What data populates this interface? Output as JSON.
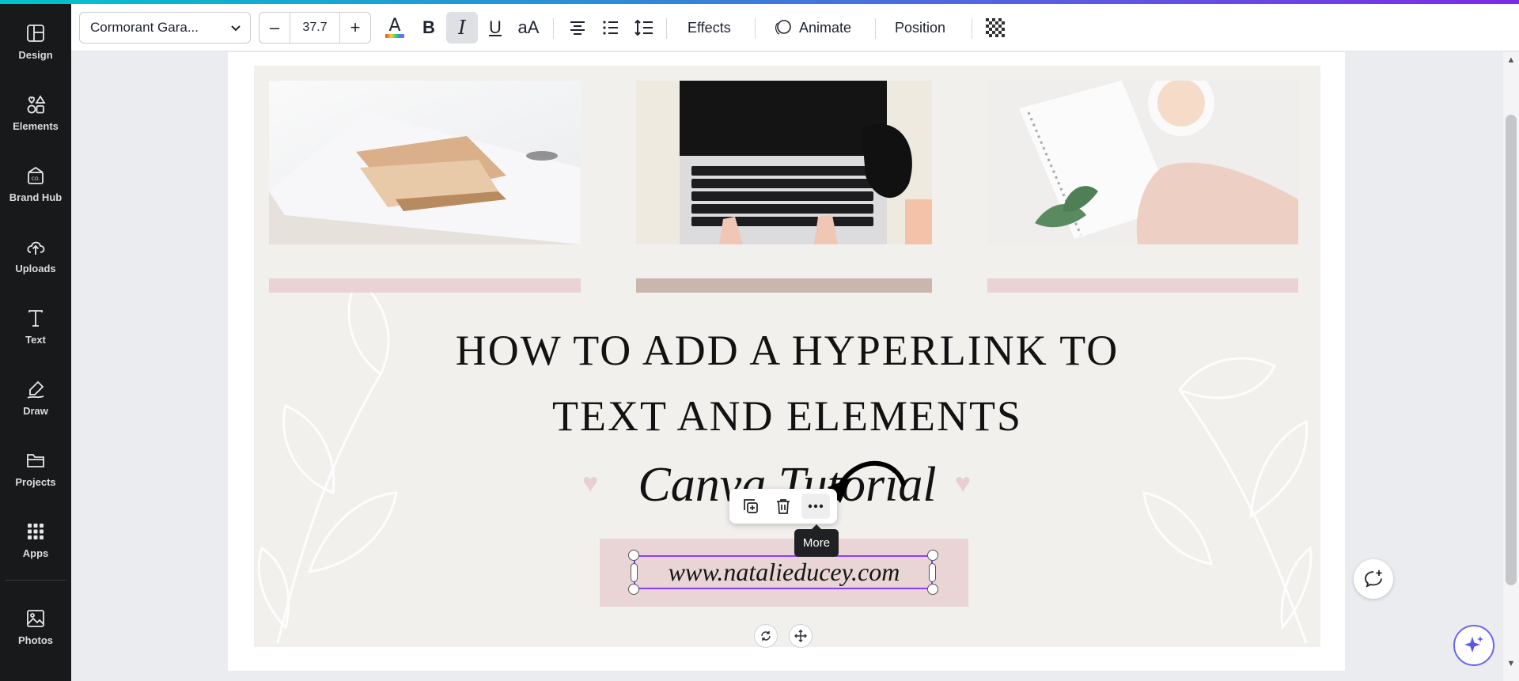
{
  "sidebar": {
    "items": [
      {
        "label": "Design",
        "icon": "design-icon"
      },
      {
        "label": "Elements",
        "icon": "elements-icon"
      },
      {
        "label": "Brand Hub",
        "icon": "brand-hub-icon"
      },
      {
        "label": "Uploads",
        "icon": "uploads-icon"
      },
      {
        "label": "Text",
        "icon": "text-icon"
      },
      {
        "label": "Draw",
        "icon": "draw-icon"
      },
      {
        "label": "Projects",
        "icon": "projects-icon"
      },
      {
        "label": "Apps",
        "icon": "apps-icon"
      },
      {
        "label": "Photos",
        "icon": "photos-icon"
      }
    ]
  },
  "toolbar": {
    "font_name": "Cormorant Gara...",
    "font_size": "37.7",
    "minus": "–",
    "plus": "+",
    "effects_label": "Effects",
    "animate_label": "Animate",
    "position_label": "Position",
    "case_label": "aA"
  },
  "canvas": {
    "title_line1": "HOW TO ADD A HYPERLINK TO",
    "title_line2": "TEXT AND ELEMENTS",
    "subtitle": "Canva Tutorial",
    "url": "www.natalieducey.com",
    "bar_colors": [
      "#ebd3d5",
      "#cbb6ad",
      "#ebd3d5"
    ]
  },
  "floating_toolbar": {
    "more_tooltip": "More"
  },
  "colors": {
    "accent": "#8b3dff",
    "sidebar_bg": "#18191b"
  }
}
